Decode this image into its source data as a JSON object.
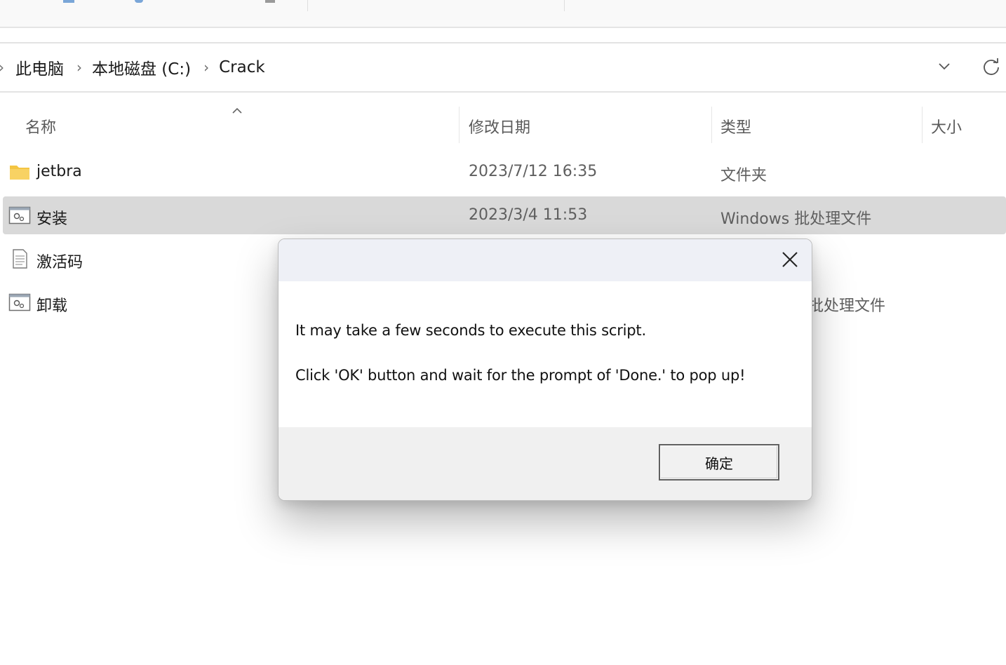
{
  "breadcrumb": {
    "items": [
      "此电脑",
      "本地磁盘 (C:)",
      "Crack"
    ]
  },
  "columns": {
    "name": "名称",
    "modified": "修改日期",
    "type": "类型",
    "size": "大小"
  },
  "files": [
    {
      "name": "jetbra",
      "modified": "2023/7/12 16:35",
      "type": "文件夹",
      "icon": "folder-icon",
      "selected": false
    },
    {
      "name": "安装",
      "modified": "2023/3/4 11:53",
      "type": "Windows 批处理文件",
      "icon": "batch-file-icon",
      "selected": true
    },
    {
      "name": "激活码",
      "modified": "",
      "type": "",
      "icon": "text-file-icon",
      "selected": false
    },
    {
      "name": "卸载",
      "modified": "",
      "type": "批处理文件",
      "icon": "batch-file-icon",
      "selected": false
    }
  ],
  "dialog": {
    "message_line1": "It may take a few seconds to execute this script.",
    "message_line2": "Click 'OK' button and wait for the prompt of 'Done.' to pop up!",
    "ok_label": "确定"
  },
  "colors": {
    "selected_row": "#d9d9d9",
    "folder": "#f4c542",
    "dialog_titlebar": "#eef0f6",
    "dialog_footer": "#f0f0f0"
  }
}
